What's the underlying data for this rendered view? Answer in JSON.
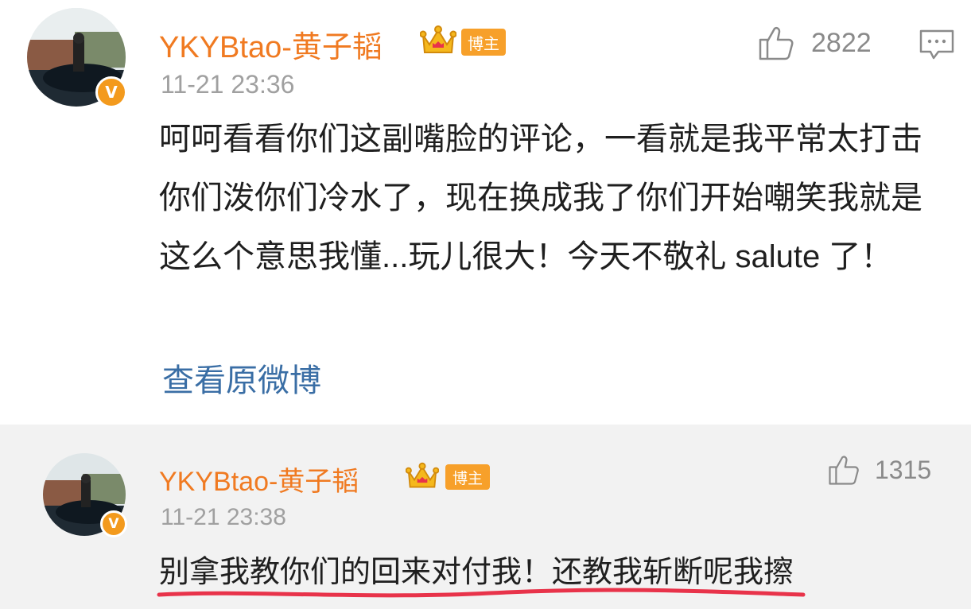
{
  "comments": [
    {
      "username": "YKYBtao-黄子韬",
      "tag": "博主",
      "time": "11-21 23:36",
      "likes": "2822",
      "text": "呵呵看看你们这副嘴脸的评论，一看就是我平常太打击你们泼你们冷水了，现在换成我了你们开始嘲笑我就是这么个意思我懂...玩儿很大！今天不敬礼 salute 了！",
      "link": "查看原微博",
      "verified_badge": "V"
    },
    {
      "username": "YKYBtao-黄子韬",
      "tag": "博主",
      "time": "11-21 23:38",
      "likes": "1315",
      "text": "别拿我教你们的回来对付我！还教我斩断呢我擦",
      "verified_badge": "V"
    }
  ],
  "icons": [
    "thumbs-up-icon",
    "reply-icon",
    "crown-icon",
    "verified-badge-icon"
  ],
  "colors": {
    "username": "#f07a21",
    "tag_bg": "#f7a02a",
    "link": "#3a6ea5",
    "underline": "#e8334a",
    "reply_bg": "#f2f2f2"
  }
}
